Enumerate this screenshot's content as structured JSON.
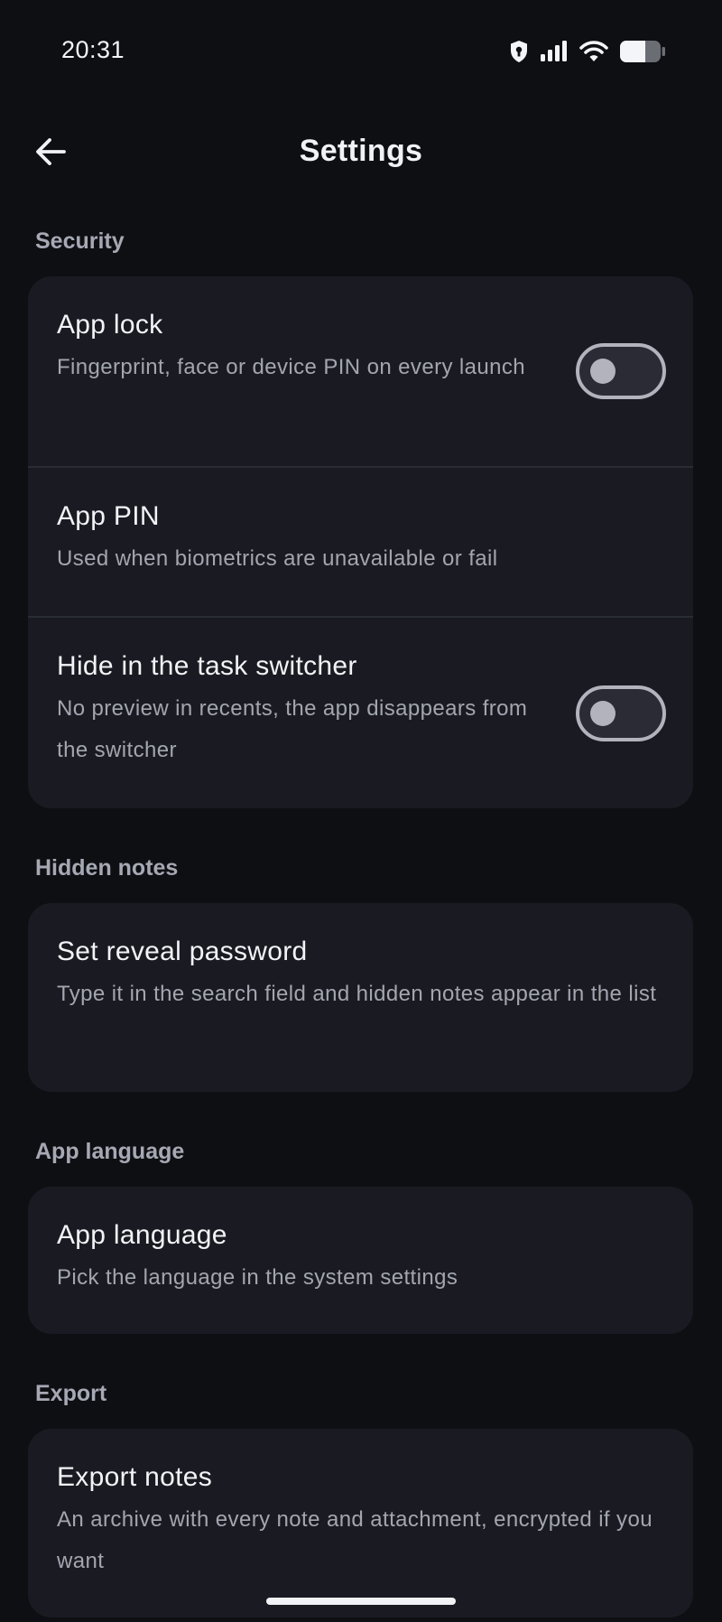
{
  "status_bar": {
    "time": "20:31",
    "icons": [
      "shield-icon",
      "signal-icon",
      "wifi-icon",
      "battery-icon"
    ]
  },
  "app_bar": {
    "back_icon": "arrow-left-icon",
    "title": "Settings"
  },
  "sections": {
    "security": {
      "header": "Security",
      "app_lock": {
        "title": "App lock",
        "subtitle": "Fingerprint, face or device PIN on every launch",
        "enabled": false
      },
      "app_pin": {
        "title": "App PIN",
        "subtitle": "Used when biometrics are unavailable or fail"
      },
      "hide_task_switcher": {
        "title": "Hide in the task switcher",
        "subtitle": "No preview in recents, the app disappears from the switcher",
        "enabled": false
      }
    },
    "hidden_notes": {
      "header": "Hidden notes",
      "reveal_password": {
        "title": "Set reveal password",
        "subtitle": "Type it in the search field and hidden notes appear in the list"
      }
    },
    "app_language": {
      "header": "App language",
      "language": {
        "title": "App language",
        "subtitle": "Pick the language in the system settings"
      }
    },
    "export": {
      "header": "Export",
      "export_notes": {
        "title": "Export notes",
        "subtitle": "An archive with every note and attachment, encrypted if you want"
      }
    }
  },
  "colors": {
    "background": "#0e0f13",
    "card": "#1a1b22",
    "section_header": "#a6a9b4",
    "subtitle": "#a3a6b0",
    "switch_off": "#b2b3bd"
  }
}
